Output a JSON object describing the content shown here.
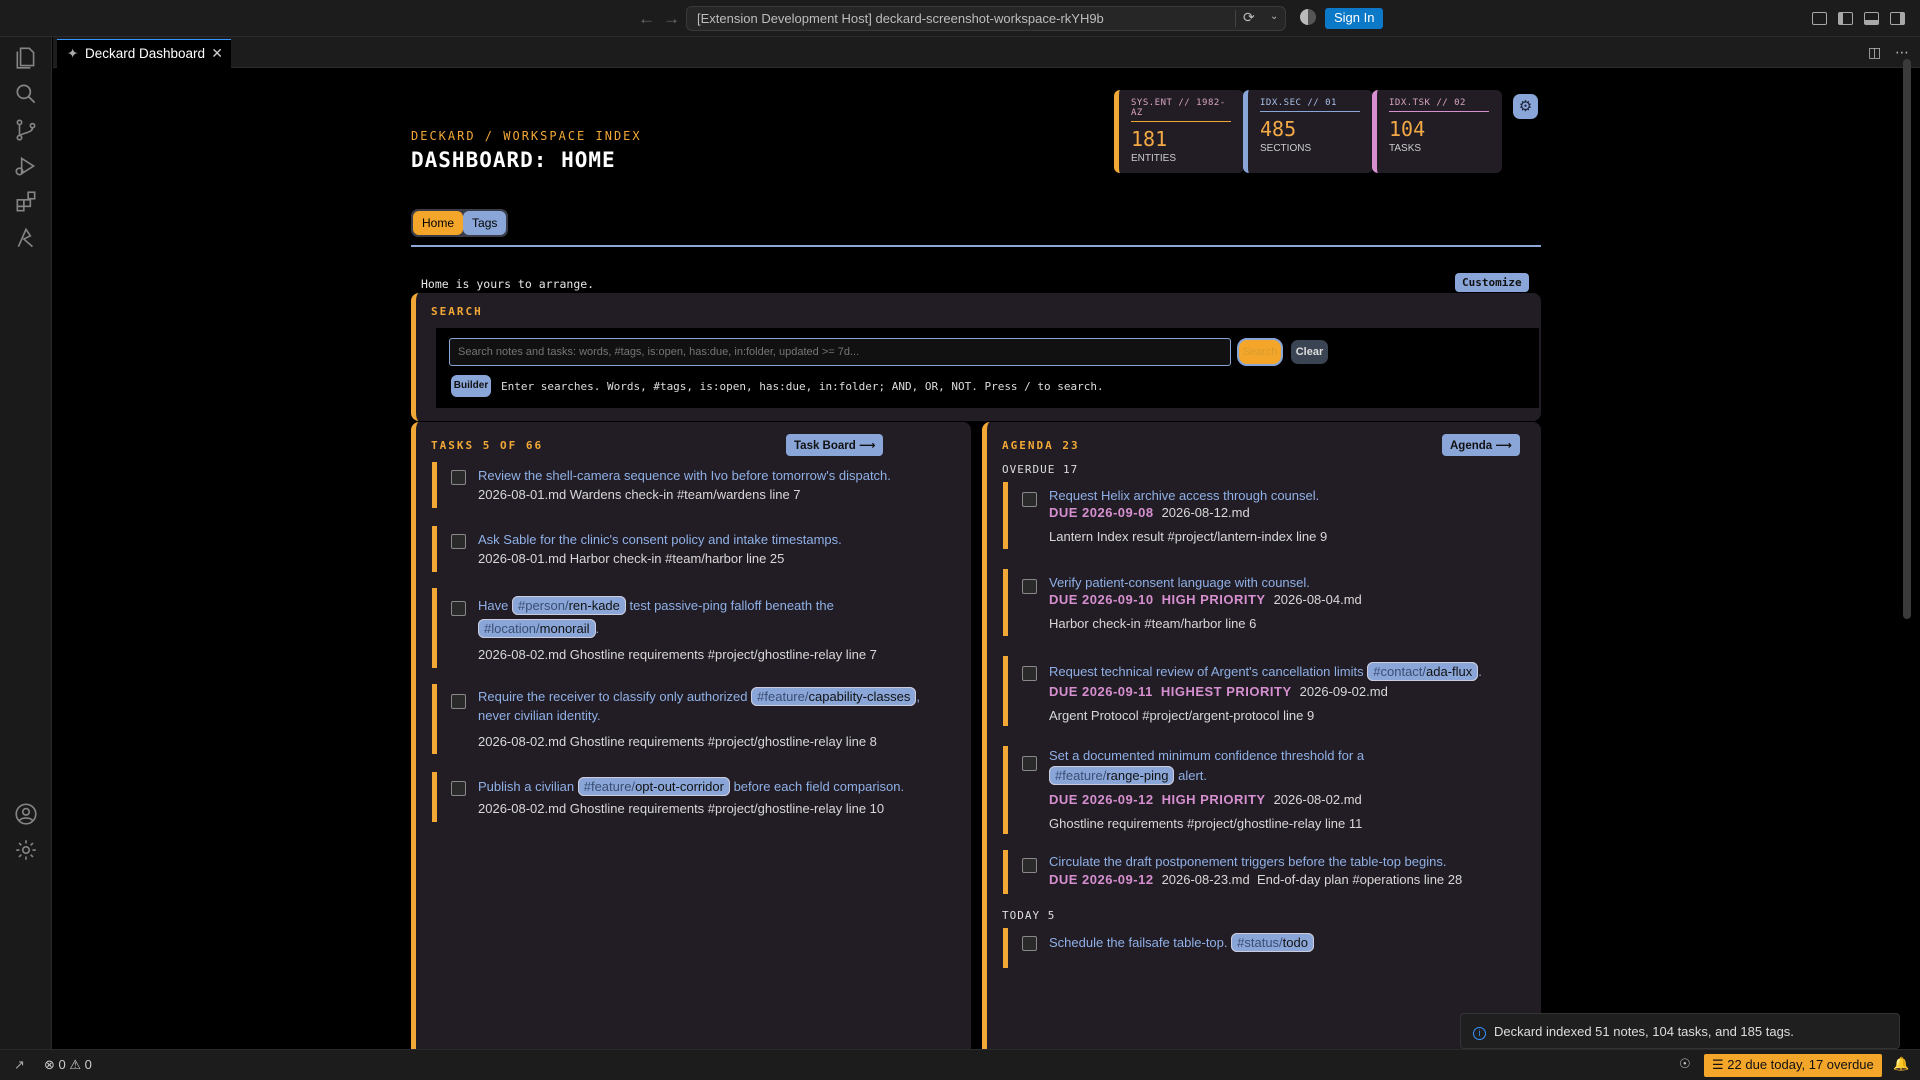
{
  "titlebar": {
    "window_title": "[Extension Development Host] deckard-screenshot-workspace-rkYH9b",
    "signin": "Sign In"
  },
  "editor_tab": {
    "label": "Deckard Dashboard"
  },
  "header": {
    "kicker": "DECKARD / WORKSPACE INDEX",
    "title": "DASHBOARD: HOME"
  },
  "stats": [
    {
      "label": "SYS.ENT // 1982-AZ",
      "value": "181",
      "unit": "ENTITIES",
      "color": "#f2a836"
    },
    {
      "label": "IDX.SEC // 01",
      "value": "485",
      "unit": "SECTIONS",
      "color": "#8aa6d8"
    },
    {
      "label": "IDX.TSK // 02",
      "value": "104",
      "unit": "TASKS",
      "color": "#d68fcf"
    }
  ],
  "tabs": {
    "home": "Home",
    "tags": "Tags"
  },
  "home_msg": "Home is yours to arrange.",
  "customize": "Customize",
  "search": {
    "title": "SEARCH",
    "placeholder": "Search notes and tasks: words, #tags, is:open, has:due, in:folder, updated >= 7d...",
    "search_btn": "Search",
    "clear_btn": "Clear",
    "builder_btn": "Builder",
    "help": "Enter searches. Words, #tags, is:open, has:due, in:folder; AND, OR, NOT. Press / to search."
  },
  "tasks": {
    "title": "TASKS 5 OF 66",
    "board_btn": "Task Board ⟶",
    "items": [
      {
        "text": "Review the shell-camera sequence with Ivo before tomorrow's dispatch.",
        "meta": "2026-08-01.md  Wardens check-in #team/wardens  line 7"
      },
      {
        "text": "Ask Sable for the clinic's consent policy and intake timestamps.",
        "meta": "2026-08-01.md  Harbor check-in #team/harbor  line 25"
      },
      {
        "text_a": "Have",
        "chip1_pre": "#person/",
        "chip1": "ren-kade",
        "text_b": "test passive-ping falloff beneath the",
        "chip2_pre": "#location/",
        "chip2": "monorail",
        "text_c": ".",
        "meta": "2026-08-02.md  Ghostline requirements #project/ghostline-relay  line 7"
      },
      {
        "text_a": "Require the receiver to classify only authorized",
        "chip1_pre": "#feature/",
        "chip1": "capability-classes",
        "text_b": ",",
        "text_c": "never civilian identity.",
        "meta": "2026-08-02.md  Ghostline requirements #project/ghostline-relay  line 8"
      },
      {
        "text_a": "Publish a civilian",
        "chip1_pre": "#feature/",
        "chip1": "opt-out-corridor",
        "text_b": "before each field comparison.",
        "meta": "2026-08-02.md  Ghostline requirements #project/ghostline-relay  line 10"
      }
    ]
  },
  "agenda": {
    "title": "AGENDA 23",
    "btn": "Agenda ⟶",
    "overdue_hdr": "OVERDUE 17",
    "today_hdr": "TODAY 5",
    "items": [
      {
        "text": "Request Helix archive access through counsel.",
        "due": "DUE 2026-09-08",
        "file": "2026-08-12.md",
        "meta": "Lantern Index result #project/lantern-index  line 9"
      },
      {
        "text": "Verify patient-consent language with counsel.",
        "due": "DUE 2026-09-10",
        "prio": "HIGH PRIORITY",
        "file": "2026-08-04.md",
        "meta": "Harbor check-in #team/harbor  line 6"
      },
      {
        "text": "Request technical review of Argent's cancellation limits",
        "chip_pre": "#contact/",
        "chip": "ada-flux",
        "tail": ".",
        "due": "DUE 2026-09-11",
        "prio": "HIGHEST PRIORITY",
        "file": "2026-09-02.md",
        "meta": "Argent Protocol #project/argent-protocol  line 9"
      },
      {
        "text": "Set a documented minimum confidence threshold for a",
        "chip_pre": "#feature/",
        "chip": "range-ping",
        "tail": "alert.",
        "due": "DUE 2026-09-12",
        "prio": "HIGH PRIORITY",
        "file": "2026-08-02.md",
        "meta": "Ghostline requirements #project/ghostline-relay  line 11"
      },
      {
        "text": "Circulate the draft postponement triggers before the table-top begins.",
        "due": "DUE 2026-09-12",
        "file": "2026-08-23.md",
        "meta": "End-of-day plan #operations  line 28"
      },
      {
        "text": "Schedule the failsafe table-top.",
        "chip_pre": "#status/",
        "chip": "todo"
      }
    ]
  },
  "toast": "Deckard indexed 51 notes, 104 tasks, and 185 tags.",
  "statusbar": {
    "errors": "0",
    "warnings": "0",
    "due": "22 due today, 17 overdue"
  }
}
